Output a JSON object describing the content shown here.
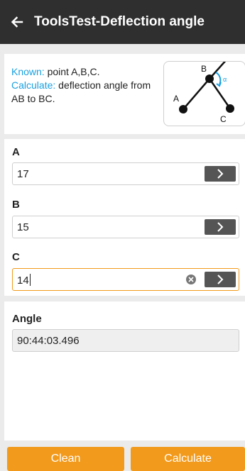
{
  "header": {
    "title": "ToolsTest-Deflection angle",
    "back_icon": "arrow-left-icon"
  },
  "info": {
    "known_label": "Known:",
    "known_value": " point A,B,C.",
    "calc_label": "Calculate:",
    "calc_value": " deflection angle from AB to BC.",
    "diagram": {
      "label_a": "A",
      "label_b": "B",
      "label_c": "C",
      "label_alpha": "α"
    }
  },
  "fields": [
    {
      "label": "A",
      "value": "17"
    },
    {
      "label": "B",
      "value": "15"
    },
    {
      "label": "C",
      "value": "14"
    }
  ],
  "result": {
    "label": "Angle",
    "value": "90:44:03.496"
  },
  "buttons": {
    "clean": "Clean",
    "calculate": "Calculate"
  },
  "colors": {
    "header_bg": "#2f2f2f",
    "accent": "#f29a1b",
    "info_blue": "#1aa0e0"
  }
}
